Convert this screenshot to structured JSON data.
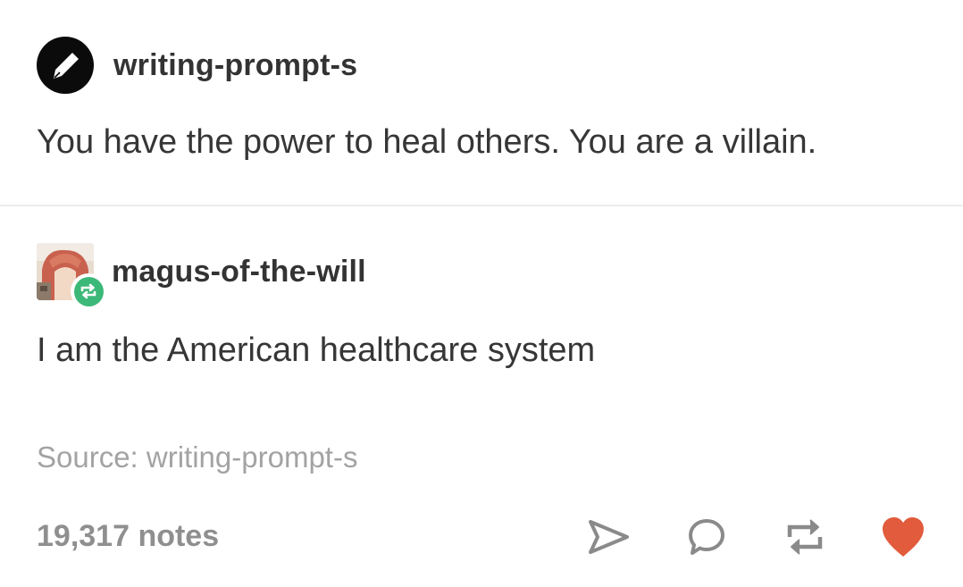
{
  "post": {
    "author": {
      "username": "writing-prompt-s",
      "avatar_icon": "pen-nib-icon"
    },
    "text": "You have the power to heal others. You are a villain."
  },
  "reblog": {
    "author": {
      "username": "magus-of-the-will",
      "avatar_icon": "anime-avatar-image",
      "badge_icon": "reblog-icon"
    },
    "text": "I am the American healthcare system"
  },
  "source": {
    "label": "Source:",
    "link": "writing-prompt-s"
  },
  "footer": {
    "notes": "19,317 notes",
    "actions": [
      {
        "icon": "share-icon"
      },
      {
        "icon": "reply-icon"
      },
      {
        "icon": "reblog-icon"
      },
      {
        "icon": "heart-icon",
        "liked": true
      }
    ]
  },
  "colors": {
    "text": "#363636",
    "muted": "#a3a3a3",
    "reblog_green": "#3cb878",
    "heart": "#e15b3c",
    "icon_gray": "#8a8a8a"
  }
}
